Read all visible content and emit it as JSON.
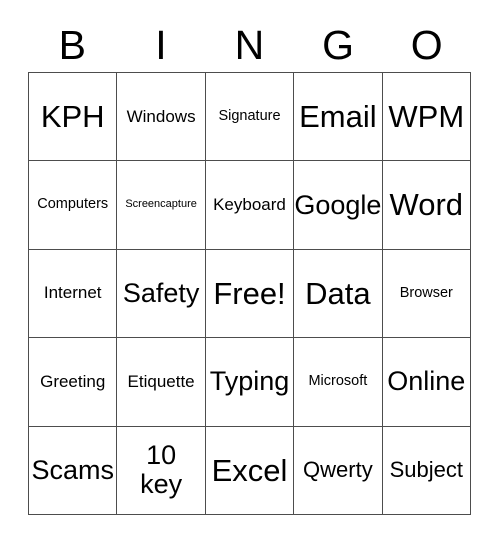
{
  "card": {
    "header_letters": [
      "B",
      "I",
      "N",
      "G",
      "O"
    ],
    "columns": 5,
    "rows": 5,
    "colors": {
      "background": "#ffffff",
      "text": "#000000",
      "grid_line": "#4d4d4d"
    },
    "cells": [
      [
        {
          "label": "KPH",
          "size": "sz-xxl"
        },
        {
          "label": "Windows",
          "size": "sz-md"
        },
        {
          "label": "Signature",
          "size": "sz-sm"
        },
        {
          "label": "Email",
          "size": "sz-xxl"
        },
        {
          "label": "WPM",
          "size": "sz-xxl"
        }
      ],
      [
        {
          "label": "Computers",
          "size": "sz-sm"
        },
        {
          "label": "Screencapture",
          "size": "sz-xs"
        },
        {
          "label": "Keyboard",
          "size": "sz-md"
        },
        {
          "label": "Google",
          "size": "sz-xl"
        },
        {
          "label": "Word",
          "size": "sz-xxl"
        }
      ],
      [
        {
          "label": "Internet",
          "size": "sz-md"
        },
        {
          "label": "Safety",
          "size": "sz-xl"
        },
        {
          "label": "Free!",
          "size": "sz-xxl"
        },
        {
          "label": "Data",
          "size": "sz-xxl"
        },
        {
          "label": "Browser",
          "size": "sz-sm"
        }
      ],
      [
        {
          "label": "Greeting",
          "size": "sz-md"
        },
        {
          "label": "Etiquette",
          "size": "sz-md"
        },
        {
          "label": "Typing",
          "size": "sz-xl"
        },
        {
          "label": "Microsoft",
          "size": "sz-sm"
        },
        {
          "label": "Online",
          "size": "sz-xl"
        }
      ],
      [
        {
          "label": "Scams",
          "size": "sz-xl"
        },
        {
          "label": "10\nkey",
          "size": "sz-xl"
        },
        {
          "label": "Excel",
          "size": "sz-xxl"
        },
        {
          "label": "Qwerty",
          "size": "sz-lg"
        },
        {
          "label": "Subject",
          "size": "sz-lg"
        }
      ]
    ]
  }
}
